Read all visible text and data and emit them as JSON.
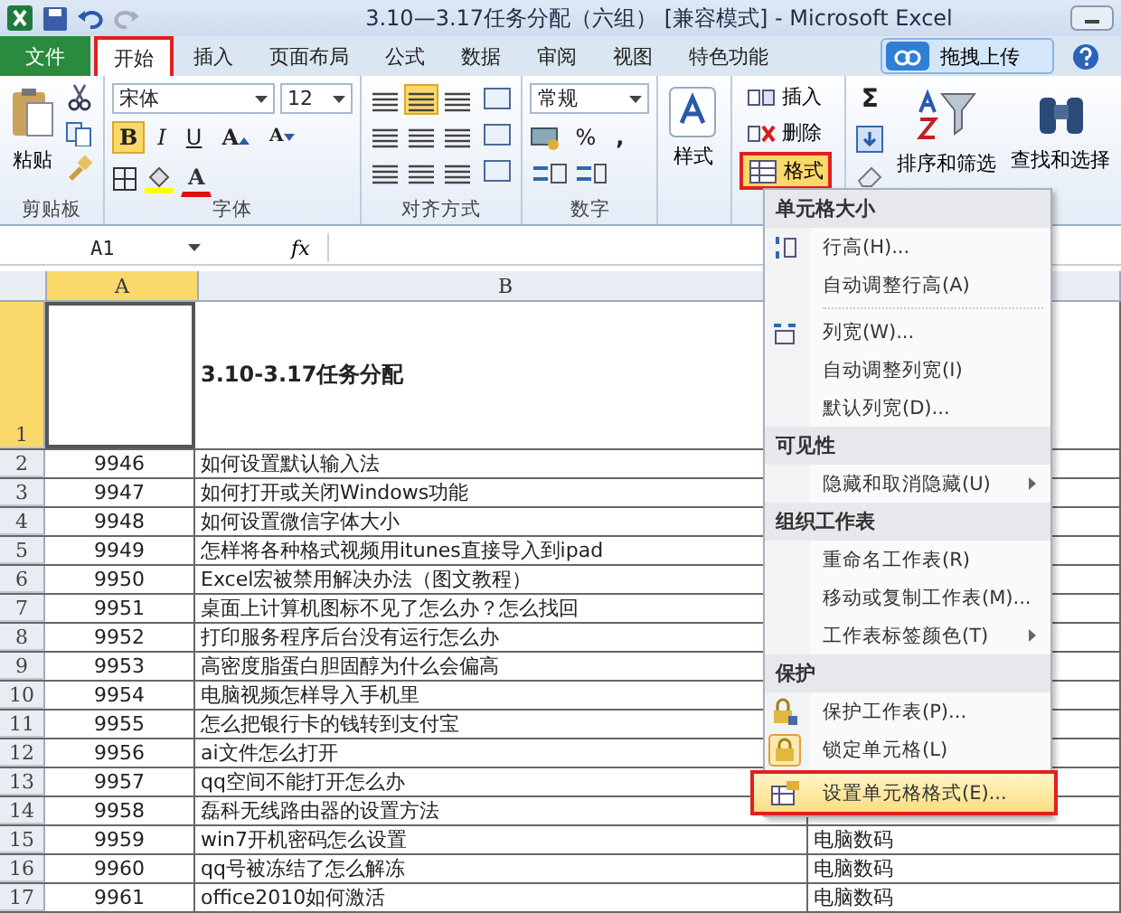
{
  "window": {
    "title": "3.10—3.17任务分配（六组） [兼容模式] - Microsoft Excel"
  },
  "tabs": [
    {
      "label": "文件",
      "kind": "file",
      "selected": false
    },
    {
      "label": "开始",
      "kind": "tab",
      "selected": true
    },
    {
      "label": "插入",
      "kind": "tab",
      "selected": false
    },
    {
      "label": "页面布局",
      "kind": "tab",
      "selected": false
    },
    {
      "label": "公式",
      "kind": "tab",
      "selected": false
    },
    {
      "label": "数据",
      "kind": "tab",
      "selected": false
    },
    {
      "label": "审阅",
      "kind": "tab",
      "selected": false
    },
    {
      "label": "视图",
      "kind": "tab",
      "selected": false
    },
    {
      "label": "特色功能",
      "kind": "tab",
      "selected": false
    }
  ],
  "upload_button": "拖拽上传",
  "ribbon": {
    "paste": "粘贴",
    "font_name": "宋体",
    "font_size": "12",
    "bold": "B",
    "italic": "I",
    "underline": "U",
    "bold_on": true,
    "grow": "A",
    "shrink": "A",
    "font_color": "A",
    "number_format": "常规",
    "percent": "%",
    "comma": ",",
    "styles": "样式",
    "insert": "插入",
    "delete": "删除",
    "format": "格式",
    "sum": "Σ",
    "sort": "排序和筛选",
    "find": "查找和选择",
    "groups": [
      "剪贴板",
      "字体",
      "对齐方式",
      "数字"
    ]
  },
  "formula_bar": {
    "name_box": "A1",
    "fx": "fx"
  },
  "columns": [
    {
      "label": "A",
      "selected": true
    },
    {
      "label": "B",
      "selected": false
    }
  ],
  "title_row": {
    "num": "1",
    "selected": true,
    "title": "3.10-3.17任务分配"
  },
  "rows": [
    {
      "num": "2",
      "id": "9946",
      "title": "如何设置默认输入法"
    },
    {
      "num": "3",
      "id": "9947",
      "title": "如何打开或关闭Windows功能"
    },
    {
      "num": "4",
      "id": "9948",
      "title": "如何设置微信字体大小"
    },
    {
      "num": "5",
      "id": "9949",
      "title": "怎样将各种格式视频用itunes直接导入到ipad"
    },
    {
      "num": "6",
      "id": "9950",
      "title": "Excel宏被禁用解决办法（图文教程）"
    },
    {
      "num": "7",
      "id": "9951",
      "title": "桌面上计算机图标不见了怎么办？怎么找回"
    },
    {
      "num": "8",
      "id": "9952",
      "title": "打印服务程序后台没有运行怎么办"
    },
    {
      "num": "9",
      "id": "9953",
      "title": "高密度脂蛋白胆固醇为什么会偏高"
    },
    {
      "num": "10",
      "id": "9954",
      "title": "电脑视频怎样导入手机里"
    },
    {
      "num": "11",
      "id": "9955",
      "title": "怎么把银行卡的钱转到支付宝"
    },
    {
      "num": "12",
      "id": "9956",
      "title": "ai文件怎么打开"
    },
    {
      "num": "13",
      "id": "9957",
      "title": "qq空间不能打开怎么办"
    },
    {
      "num": "14",
      "id": "9958",
      "title": "磊科无线路由器的设置方法"
    },
    {
      "num": "15",
      "id": "9959",
      "title": "win7开机密码怎么设置",
      "category": "电脑数码"
    },
    {
      "num": "16",
      "id": "9960",
      "title": "qq号被冻结了怎么解冻",
      "category": "电脑数码"
    },
    {
      "num": "17",
      "id": "9961",
      "title": "office2010如何激活",
      "category": "电脑数码"
    }
  ],
  "menu": [
    {
      "kind": "header",
      "label": "单元格大小"
    },
    {
      "kind": "item",
      "label": "行高(H)...",
      "submenu": false,
      "selected": false
    },
    {
      "kind": "item",
      "label": "自动调整行高(A)",
      "submenu": false,
      "selected": false
    },
    {
      "kind": "separator"
    },
    {
      "kind": "item",
      "label": "列宽(W)...",
      "submenu": false,
      "selected": false
    },
    {
      "kind": "item",
      "label": "自动调整列宽(I)",
      "submenu": false,
      "selected": false
    },
    {
      "kind": "item",
      "label": "默认列宽(D)...",
      "submenu": false,
      "selected": false
    },
    {
      "kind": "header",
      "label": "可见性"
    },
    {
      "kind": "item",
      "label": "隐藏和取消隐藏(U)",
      "submenu": true,
      "selected": false
    },
    {
      "kind": "header",
      "label": "组织工作表"
    },
    {
      "kind": "item",
      "label": "重命名工作表(R)",
      "submenu": false,
      "selected": false
    },
    {
      "kind": "item",
      "label": "移动或复制工作表(M)...",
      "submenu": false,
      "selected": false
    },
    {
      "kind": "item",
      "label": "工作表标签颜色(T)",
      "submenu": true,
      "selected": false
    },
    {
      "kind": "header",
      "label": "保护"
    },
    {
      "kind": "item",
      "label": "保护工作表(P)...",
      "submenu": false,
      "selected": false
    },
    {
      "kind": "item",
      "label": "锁定单元格(L)",
      "submenu": false,
      "selected": false
    },
    {
      "kind": "item",
      "label": "设置单元格格式(E)...",
      "submenu": false,
      "selected": true
    }
  ]
}
